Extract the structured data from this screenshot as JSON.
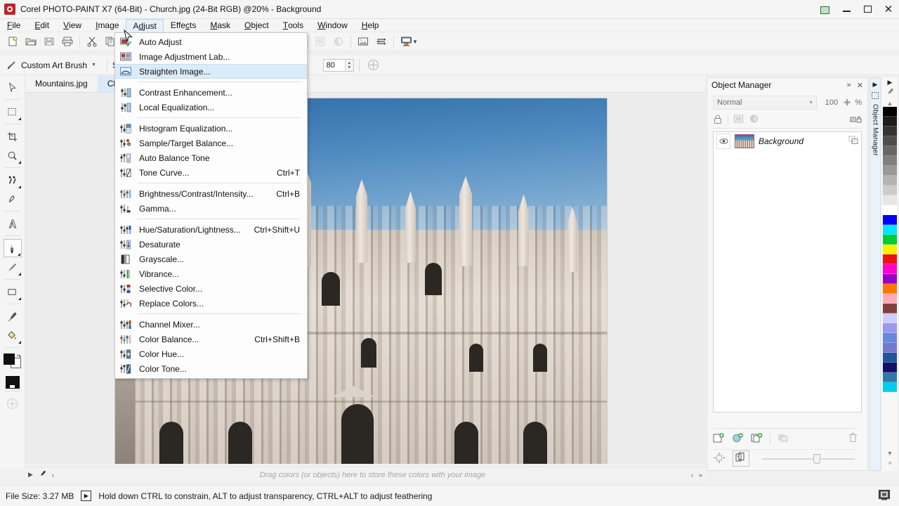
{
  "window": {
    "title": "Corel PHOTO-PAINT X7 (64-Bit) - Church.jpg (24-Bit RGB) @20% - Background",
    "app_icon": "corel-photopaint-icon",
    "controls": {
      "restore": "restore-window",
      "minimize": "minimize-window",
      "maximize": "maximize-window",
      "close": "close-window"
    }
  },
  "menubar": {
    "items": [
      {
        "label": "File",
        "mnemonic": "F"
      },
      {
        "label": "Edit",
        "mnemonic": "E"
      },
      {
        "label": "View",
        "mnemonic": "V"
      },
      {
        "label": "Image",
        "mnemonic": "I"
      },
      {
        "label": "Adjust",
        "mnemonic": "j",
        "active": true
      },
      {
        "label": "Effects",
        "mnemonic": "c"
      },
      {
        "label": "Mask",
        "mnemonic": "M"
      },
      {
        "label": "Object",
        "mnemonic": "O"
      },
      {
        "label": "Tools",
        "mnemonic": "T"
      },
      {
        "label": "Window",
        "mnemonic": "W"
      },
      {
        "label": "Help",
        "mnemonic": "H"
      }
    ]
  },
  "adjust_menu": {
    "open": true,
    "groups": [
      {
        "items": [
          {
            "label": "Auto Adjust",
            "accel": "",
            "icon": "auto-adjust-icon"
          },
          {
            "label": "Image Adjustment Lab...",
            "accel": "",
            "icon": "image-adjustment-lab-icon"
          },
          {
            "label": "Straighten Image...",
            "accel": "",
            "icon": "straighten-image-icon",
            "highlighted": true
          }
        ]
      },
      {
        "items": [
          {
            "label": "Contrast Enhancement...",
            "accel": "",
            "icon": "contrast-enhancement-icon"
          },
          {
            "label": "Local Equalization...",
            "accel": "",
            "icon": "local-equalization-icon"
          }
        ]
      },
      {
        "items": [
          {
            "label": "Histogram Equalization...",
            "accel": "",
            "icon": "histogram-equalization-icon"
          },
          {
            "label": "Sample/Target Balance...",
            "accel": "",
            "icon": "sample-target-balance-icon"
          },
          {
            "label": "Auto Balance Tone",
            "accel": "",
            "icon": "auto-balance-tone-icon"
          },
          {
            "label": "Tone Curve...",
            "accel": "Ctrl+T",
            "icon": "tone-curve-icon"
          }
        ]
      },
      {
        "items": [
          {
            "label": "Brightness/Contrast/Intensity...",
            "accel": "Ctrl+B",
            "icon": "brightness-contrast-icon"
          },
          {
            "label": "Gamma...",
            "accel": "",
            "icon": "gamma-icon"
          }
        ]
      },
      {
        "items": [
          {
            "label": "Hue/Saturation/Lightness...",
            "accel": "Ctrl+Shift+U",
            "icon": "hue-saturation-icon"
          },
          {
            "label": "Desaturate",
            "accel": "",
            "icon": "desaturate-icon"
          },
          {
            "label": "Grayscale...",
            "accel": "",
            "icon": "grayscale-icon"
          },
          {
            "label": "Vibrance...",
            "accel": "",
            "icon": "vibrance-icon"
          },
          {
            "label": "Selective Color...",
            "accel": "",
            "icon": "selective-color-icon"
          },
          {
            "label": "Replace Colors...",
            "accel": "",
            "icon": "replace-colors-icon"
          }
        ]
      },
      {
        "items": [
          {
            "label": "Channel Mixer...",
            "accel": "",
            "icon": "channel-mixer-icon"
          },
          {
            "label": "Color Balance...",
            "accel": "Ctrl+Shift+B",
            "icon": "color-balance-icon"
          },
          {
            "label": "Color Hue...",
            "accel": "",
            "icon": "color-hue-icon"
          },
          {
            "label": "Color Tone...",
            "accel": "",
            "icon": "color-tone-icon"
          }
        ]
      }
    ]
  },
  "toolbar": {
    "buttons": [
      "new-document-icon",
      "open-document-icon",
      "save-icon",
      "print-icon",
      "cut-icon",
      "copy-icon",
      "paste-icon",
      "undo-icon",
      "redo-icon",
      "import-icon",
      "export-icon",
      "zoom-level-icon",
      "fullscreen-preview-icon",
      "move-icon",
      "crop-icon",
      "transform-icon",
      "effects-icon",
      "mask-preview-icon",
      "mask-overlay-icon",
      "clear-mask-icon",
      "invert-mask-icon",
      "image-adjust-icon",
      "layers-icon",
      "application-launcher-icon"
    ]
  },
  "propertybar": {
    "brush_label": "Custom Art Brush",
    "shape_label": "Shape",
    "nib_size": "80",
    "add_icon": "add-nib-icon"
  },
  "toolbox": {
    "tools": [
      {
        "name": "pick-tool",
        "icon": "arrow-cursor-icon"
      },
      {
        "name": "mask-rectangle-tool",
        "icon": "rectangle-mask-icon"
      },
      {
        "name": "crop-tool",
        "icon": "crop-icon"
      },
      {
        "name": "zoom-tool",
        "icon": "magnifier-icon"
      },
      {
        "name": "clone-tool",
        "icon": "clone-icon"
      },
      {
        "name": "eraser-tool",
        "icon": "eraser-icon"
      },
      {
        "name": "text-tool",
        "icon": "text-a-icon"
      },
      {
        "name": "paint-tool",
        "icon": "paintbrush-icon",
        "selected": true
      },
      {
        "name": "effect-tool",
        "icon": "smudge-icon"
      },
      {
        "name": "rectangle-shape-tool",
        "icon": "rectangle-shape-icon"
      },
      {
        "name": "eyedropper-tool",
        "icon": "eyedropper-icon"
      },
      {
        "name": "fill-tool",
        "icon": "paint-bucket-icon"
      }
    ],
    "color_swatches": {
      "foreground": "#111111",
      "background": "#ffffff"
    },
    "quick_customize": "quick-customize-icon"
  },
  "documents": {
    "tabs": [
      {
        "label": "Mountains.jpg",
        "active": false
      },
      {
        "label": "Church.jpg",
        "active": true
      }
    ]
  },
  "canvas": {
    "image_name": "Church.jpg",
    "zoom": "20%",
    "description": "Duomo di Milano cathedral facade against blue sky"
  },
  "docker": {
    "title": "Object Manager",
    "vertical_tab": "Object Manager",
    "collapse_icon": "collapse-docker-icon",
    "close_icon": "close-docker-icon",
    "blend_mode": "Normal",
    "opacity": "100",
    "opacity_unit": "%",
    "lock_icon": "lock-transparency-icon",
    "mask_icon": "object-mask-icon",
    "clip_icon": "clip-mask-icon",
    "lock_obj_icon": "lock-object-icon",
    "objects": [
      {
        "name": "Background",
        "visible": true,
        "thumbnail": "background-thumbnail",
        "link_icon": "object-properties-icon"
      }
    ],
    "footer_buttons": [
      "new-object-icon",
      "new-lens-icon",
      "duplicate-object-icon",
      "combine-objects-icon",
      "delete-object-icon"
    ],
    "footer_row2": [
      "align-objects-icon",
      "object-order-icon"
    ]
  },
  "palette": {
    "scroll_up_icon": "palette-scroll-up-icon",
    "scroll_down_icon": "palette-scroll-down-icon",
    "expand_icon": "palette-expand-icon",
    "picker_icon": "palette-picker-icon",
    "no_color_icon": "no-color-icon",
    "colors": [
      "#000000",
      "#1c1c1c",
      "#333333",
      "#4d4d4d",
      "#666666",
      "#808080",
      "#999999",
      "#b3b3b3",
      "#cccccc",
      "#e6e6e6",
      "#ffffff",
      "#0000ff",
      "#00e5ff",
      "#00cc33",
      "#ffee00",
      "#ee1111",
      "#ff00cc",
      "#9900cc",
      "#ff7700",
      "#ffaabb",
      "#804040",
      "#ccccff",
      "#9999ee",
      "#6688dd",
      "#7777cc",
      "#225599",
      "#111166",
      "#3377aa",
      "#00ccee"
    ]
  },
  "colorbar": {
    "hint": "Drag colors (or objects) here to store these colors with your image",
    "left_icons": [
      "colorbar-prev-icon",
      "eyedropper-icon",
      "colorbar-scroll-left-icon"
    ],
    "right_icons": [
      "colorbar-scroll-right-icon",
      "colorbar-more-icon"
    ]
  },
  "statusbar": {
    "file_size_label": "File Size: 3.27 MB",
    "expand_icon": "statusbar-expand-icon",
    "hint": "Hold down CTRL to constrain, ALT to adjust transparency, CTRL+ALT to adjust feathering"
  },
  "colors": {
    "accent": "#dcebf9",
    "accent_border": "#c4ddf2",
    "chrome": "#f5f5f5",
    "canvas_bg": "#ececec"
  }
}
